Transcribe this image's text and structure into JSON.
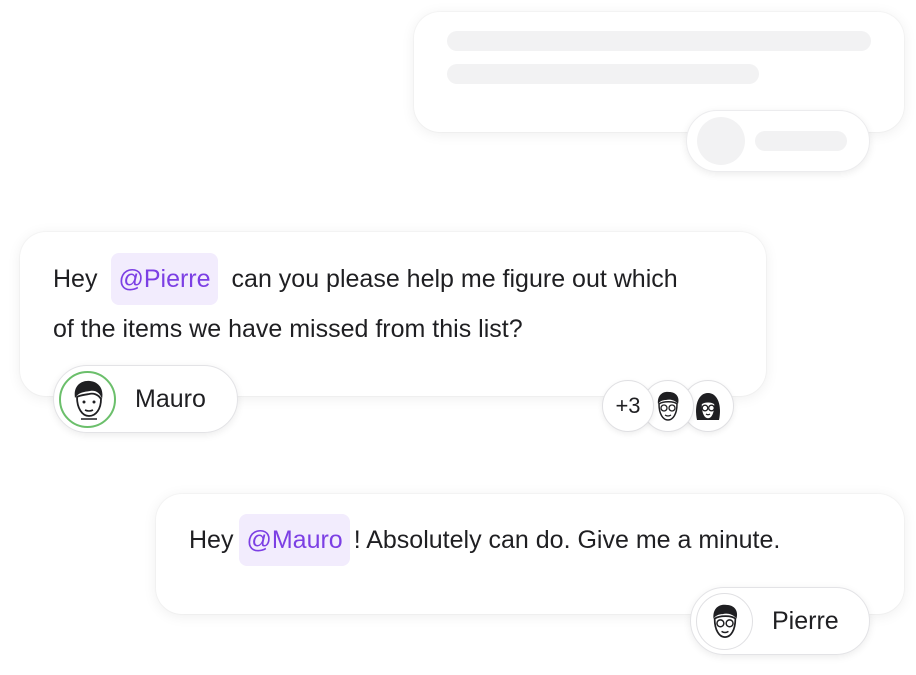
{
  "placeholder_message": {
    "lines": 2
  },
  "message_1": {
    "greeting": "Hey",
    "mention": "@Pierre",
    "line1_rest": "can you please help me figure out which",
    "line2": "of the items we have missed from this list?",
    "author": {
      "name": "Mauro",
      "avatar_icon": "mauro-avatar-icon",
      "ring_color": "#6bbf6b"
    },
    "participants": {
      "more_count": "+3",
      "avatars": [
        "man-with-glasses-avatar-icon",
        "woman-with-glasses-avatar-icon"
      ]
    }
  },
  "message_2": {
    "greeting": "Hey",
    "mention": "@Mauro",
    "rest": "! Absolutely can do. Give me a minute.",
    "author": {
      "name": "Pierre",
      "avatar_icon": "pierre-avatar-icon"
    }
  },
  "colors": {
    "mention_bg": "#f2ecfd",
    "mention_text": "#7c3fe4",
    "skeleton": "#f2f2f3"
  }
}
